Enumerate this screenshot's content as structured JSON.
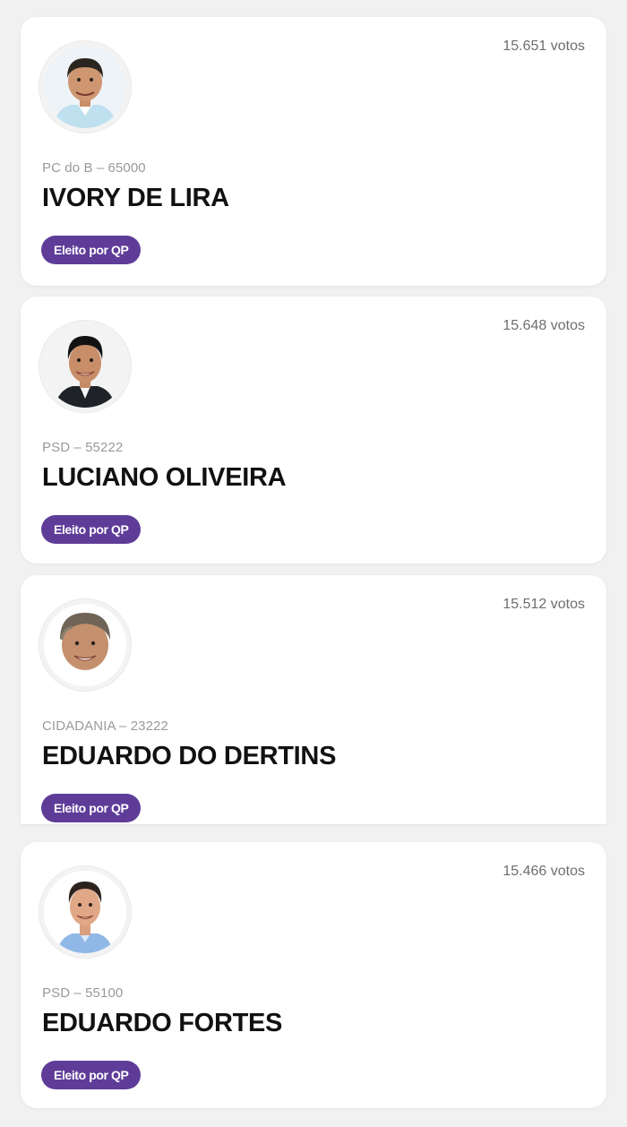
{
  "candidates": [
    {
      "votes": "15.651 votos",
      "party": "PC do B – 65000",
      "name": "IVORY DE LIRA",
      "badge": "Eleito por QP",
      "photo_icon": "candidate-photo"
    },
    {
      "votes": "15.648 votos",
      "party": "PSD – 55222",
      "name": "LUCIANO OLIVEIRA",
      "badge": "Eleito por QP",
      "photo_icon": "candidate-photo"
    },
    {
      "votes": "15.512 votos",
      "party": "CIDADANIA – 23222",
      "name": "EDUARDO DO DERTINS",
      "badge": "Eleito por QP",
      "photo_icon": "candidate-photo"
    },
    {
      "votes": "15.466 votos",
      "party": "PSD – 55100",
      "name": "EDUARDO FORTES",
      "badge": "Eleito por QP",
      "photo_icon": "candidate-photo"
    }
  ],
  "colors": {
    "badge_background": "#5e3c98",
    "badge_text": "#ffffff",
    "page_background": "#f1f1f1",
    "card_background": "#ffffff"
  }
}
